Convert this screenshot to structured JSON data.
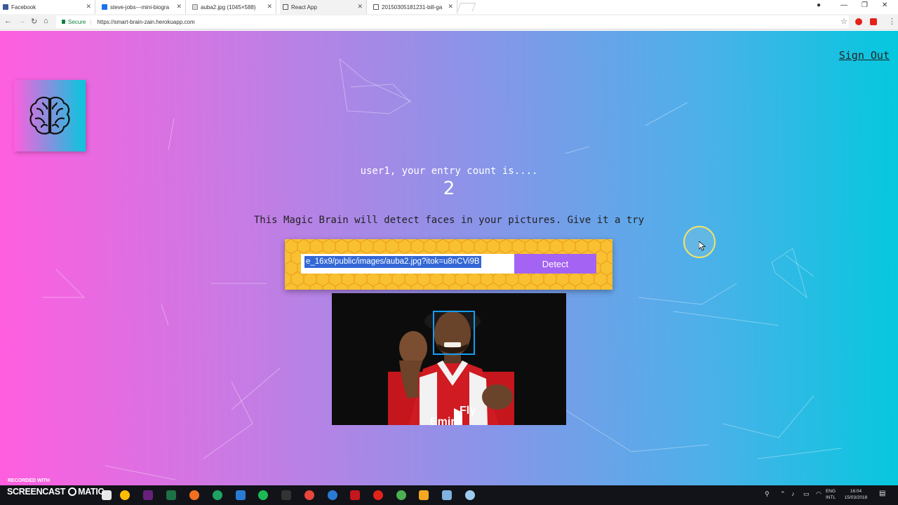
{
  "browser": {
    "tabs": [
      {
        "title": "Facebook",
        "color": "#3b5998"
      },
      {
        "title": "steve-jobs---mini-biogra",
        "color": "#1a73e8"
      },
      {
        "title": "auba2.jpg (1045×588)",
        "color": "#888888"
      },
      {
        "title": "React App",
        "color": "#61dafb"
      },
      {
        "title": "20150305181231-bill-ga",
        "color": "#555555"
      }
    ],
    "active_tab_index": 3,
    "secure_label": "Secure",
    "url": "https://smart-brain-zain.herokuapp.com"
  },
  "app": {
    "signout_label": "Sign Out",
    "logo_icon": "brain-icon",
    "rank_text": "user1, your entry count is....",
    "entry_count": "2",
    "tagline": "This Magic Brain will detect faces in your pictures. Give it a try",
    "image_url_value": "e_16x9/public/images/auba2.jpg?itok=u8nCVi9B",
    "detect_label": "Detect",
    "face_box_color": "#149df2",
    "gradient_colors": [
      "#ff5edf",
      "#04c8de"
    ],
    "form_color": "#f9c031",
    "button_color": "#a463f2"
  },
  "taskbar": {
    "recorded_with": "RECORDED WITH",
    "screencast_brand": "SCREENCAST",
    "screencast_brand_suffix": "MATIC",
    "language_top": "ENG",
    "language_bottom": "INTL",
    "time": "16:04",
    "date": "15/03/2018"
  }
}
